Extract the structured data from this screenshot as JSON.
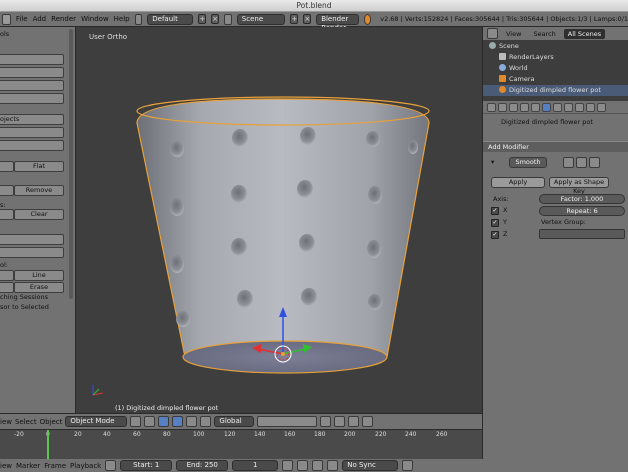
{
  "window": {
    "title": "Pot.blend"
  },
  "info": {
    "menus": [
      "File",
      "Add",
      "Render",
      "Window",
      "Help"
    ],
    "layout": "Default",
    "scene": "Scene",
    "engine": "Blender Render",
    "stats": "v2.68 | Verts:152824 | Faces:305644 | Tris:305644 | Objects:1/3 | Lamps:0/1"
  },
  "toolshelf": {
    "fragments": [
      "ols",
      "ojects",
      "Flat",
      "Remove",
      "s:",
      "Clear",
      "ol:",
      "Line",
      "Erase",
      "ching Sessions",
      "sor to Selected"
    ]
  },
  "viewport": {
    "view_label": "User Ortho",
    "object_label": "(1) Digitized dimpled flower pot",
    "header": {
      "menus": [
        "iew",
        "Select",
        "Object"
      ],
      "mode": "Object Mode",
      "orientation": "Global"
    }
  },
  "timeline": {
    "ruler": [
      "-20",
      "0",
      "20",
      "40",
      "60",
      "80",
      "100",
      "120",
      "140",
      "160",
      "180",
      "200",
      "220",
      "240",
      "260"
    ],
    "header": {
      "menus": [
        "iew",
        "Marker",
        "Frame",
        "Playback"
      ],
      "start": "Start: 1",
      "end": "End: 250",
      "current": "1",
      "sync": "No Sync"
    }
  },
  "outliner": {
    "header": {
      "view": "View",
      "search": "Search",
      "scenes": "All Scenes"
    },
    "rows": [
      "Scene",
      "RenderLayers",
      "World",
      "Camera",
      "Digitized dimpled flower pot"
    ]
  },
  "properties": {
    "object_name": "Digitized dimpled flower pot",
    "add_modifier": "Add Modifier",
    "modifier_name": "Smooth",
    "apply": "Apply",
    "apply_shape": "Apply as Shape Key",
    "axis_label": "Axis:",
    "factor": "Factor: 1.000",
    "repeat": "Repeat: 6",
    "axis_x": "X",
    "axis_y": "Y",
    "axis_z": "Z",
    "vertex_group": "Vertex Group:"
  },
  "colors": {
    "accent": "#5680c2",
    "selection_outline": "#e8a13a",
    "timeline_cursor": "#5cc650"
  }
}
